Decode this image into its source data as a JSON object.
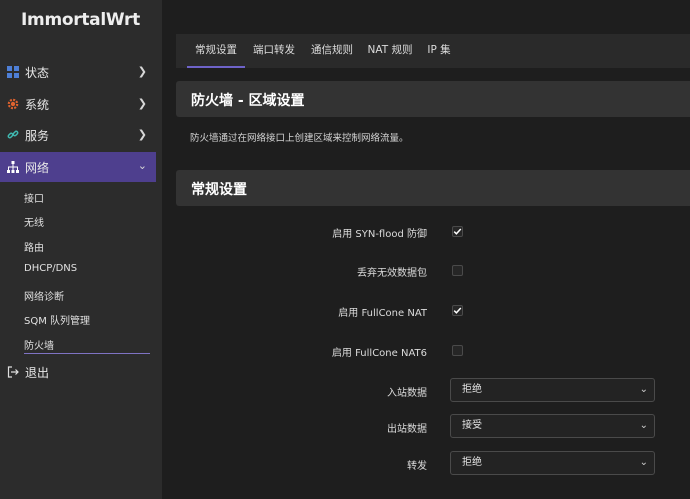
{
  "brand": "ImmortalWrt",
  "sidebar": {
    "menu": [
      {
        "label": "状态",
        "icon": "dashboard-icon",
        "has_chevron": true
      },
      {
        "label": "系统",
        "icon": "gear-icon",
        "has_chevron": true
      },
      {
        "label": "服务",
        "icon": "link-icon",
        "has_chevron": true
      },
      {
        "label": "网络",
        "icon": "network-icon",
        "has_chevron": true,
        "active": true
      }
    ],
    "submenu": [
      "接口",
      "无线",
      "路由",
      "DHCP/DNS",
      "网络诊断",
      "SQM 队列管理",
      "防火墙"
    ],
    "logout": "退出"
  },
  "tabs": [
    "常规设置",
    "端口转发",
    "通信规则",
    "NAT 规则",
    "IP 集"
  ],
  "page": {
    "title": "防火墙 - 区域设置",
    "description": "防火墙通过在网络接口上创建区域来控制网络流量。"
  },
  "general": {
    "title": "常规设置",
    "checkboxes": [
      {
        "label": "启用 SYN-flood 防御",
        "checked": true
      },
      {
        "label": "丢弃无效数据包",
        "checked": false
      },
      {
        "label": "启用 FullCone NAT",
        "checked": true
      },
      {
        "label": "启用 FullCone NAT6",
        "checked": false
      }
    ],
    "selects": [
      {
        "label": "入站数据",
        "value": "拒绝"
      },
      {
        "label": "出站数据",
        "value": "接受"
      },
      {
        "label": "转发",
        "value": "拒绝"
      }
    ]
  },
  "colors": {
    "accent": "#4e3f8e",
    "tab_underline": "#6e63c9",
    "sidebar_bg": "#2c2c2c",
    "page_bg": "#1e1e1e"
  }
}
